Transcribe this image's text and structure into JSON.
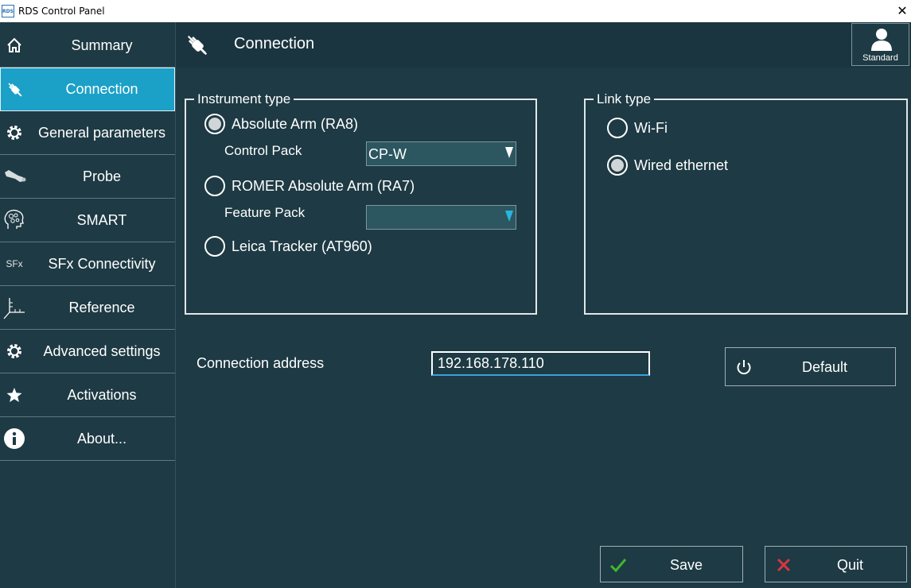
{
  "window": {
    "title": "RDS Control Panel",
    "app_icon": "RDS",
    "close_glyph": "✕"
  },
  "sidebar": {
    "items": [
      {
        "label": "Summary",
        "icon": "home-icon"
      },
      {
        "label": "Connection",
        "icon": "plug-icon",
        "active": true
      },
      {
        "label": "General parameters",
        "icon": "gear-icon"
      },
      {
        "label": "Probe",
        "icon": "probe-icon"
      },
      {
        "label": "SMART",
        "icon": "brain-icon"
      },
      {
        "label": "SFx Connectivity",
        "icon": "sfx-icon",
        "icon_text": "SFx"
      },
      {
        "label": "Reference",
        "icon": "axes-icon"
      },
      {
        "label": "Advanced settings",
        "icon": "gear-icon"
      },
      {
        "label": "Activations",
        "icon": "star-icon"
      },
      {
        "label": "About...",
        "icon": "info-icon"
      }
    ]
  },
  "header": {
    "title": "Connection",
    "user_label": "Standard"
  },
  "instrument": {
    "legend": "Instrument type",
    "options": [
      {
        "label": "Absolute Arm (RA8)",
        "checked": true
      },
      {
        "label": "ROMER Absolute Arm (RA7)",
        "checked": false
      },
      {
        "label": "Leica Tracker (AT960)",
        "checked": false
      }
    ],
    "control_pack_label": "Control Pack",
    "control_pack_value": "CP-W",
    "feature_pack_label": "Feature Pack",
    "feature_pack_value": ""
  },
  "link": {
    "legend": "Link type",
    "options": [
      {
        "label": "Wi-Fi",
        "checked": false
      },
      {
        "label": "Wired ethernet",
        "checked": true
      }
    ]
  },
  "connection": {
    "label": "Connection address",
    "value": "192.168.178.110"
  },
  "buttons": {
    "default": "Default",
    "save": "Save",
    "quit": "Quit"
  },
  "colors": {
    "background": "#1e3a44",
    "active_nav": "#1ba0c8",
    "save_check": "#3fb82b",
    "quit_x": "#d9363e",
    "accent_blue": "#2ab4e0"
  }
}
